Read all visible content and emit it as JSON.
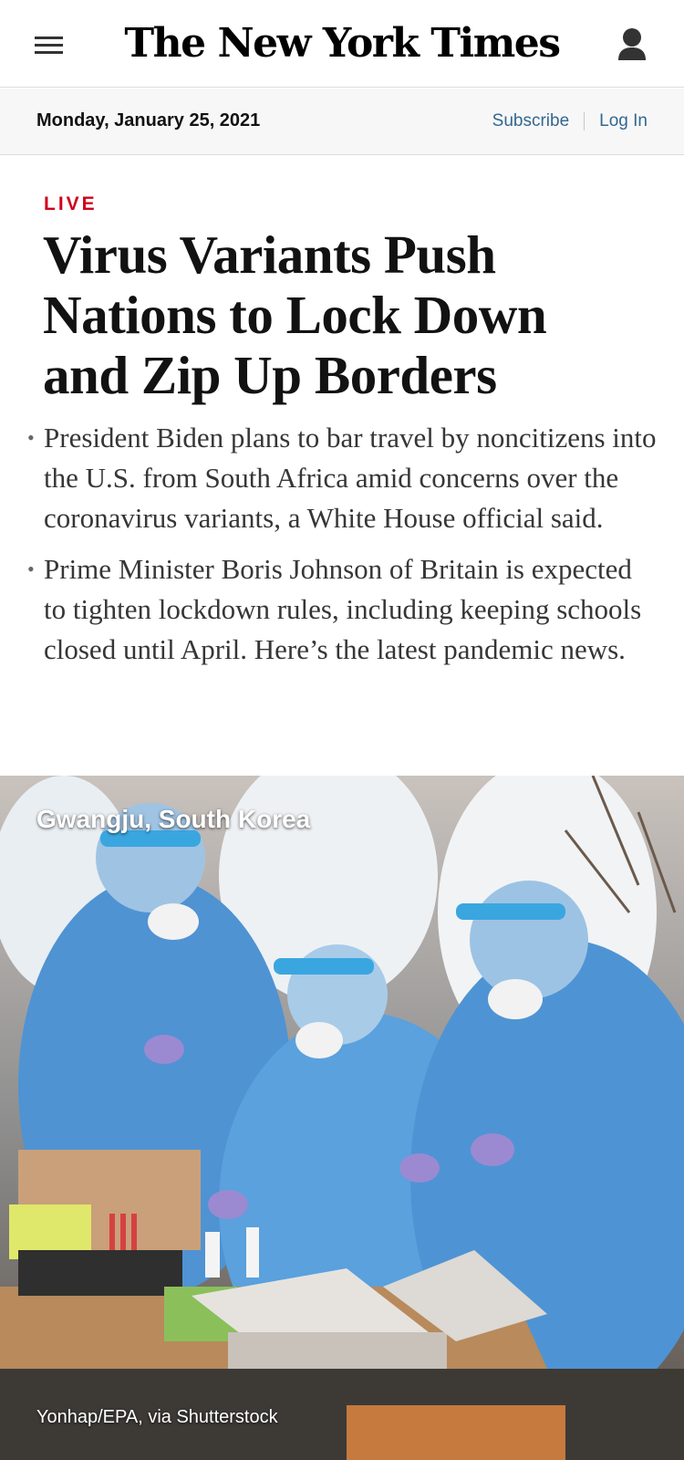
{
  "header": {
    "logo_text": "The New York Times",
    "menu_icon": "hamburger-menu-icon",
    "account_icon": "user-account-icon"
  },
  "datebar": {
    "date": "Monday, January 25, 2021",
    "subscribe": "Subscribe",
    "login": "Log In"
  },
  "article": {
    "label": "LIVE",
    "headline": "Virus Variants Push Nations to Lock Down and Zip Up Borders",
    "summary": [
      "President Biden plans to bar travel by noncitizens into the U.S. from South Africa amid concerns over the coronavirus variants, a White House official said.",
      "Prime Minister Boris Johnson of Britain is expected to tighten lockdown rules, including keeping schools closed until April. Here’s the latest pandemic news."
    ]
  },
  "photo": {
    "caption": "Gwangju, South Korea",
    "credit": "Yonhap/EPA, via Shutterstock"
  },
  "colors": {
    "live_red": "#d0021b",
    "link_blue": "#326891",
    "datebar_bg": "#f7f7f7"
  }
}
